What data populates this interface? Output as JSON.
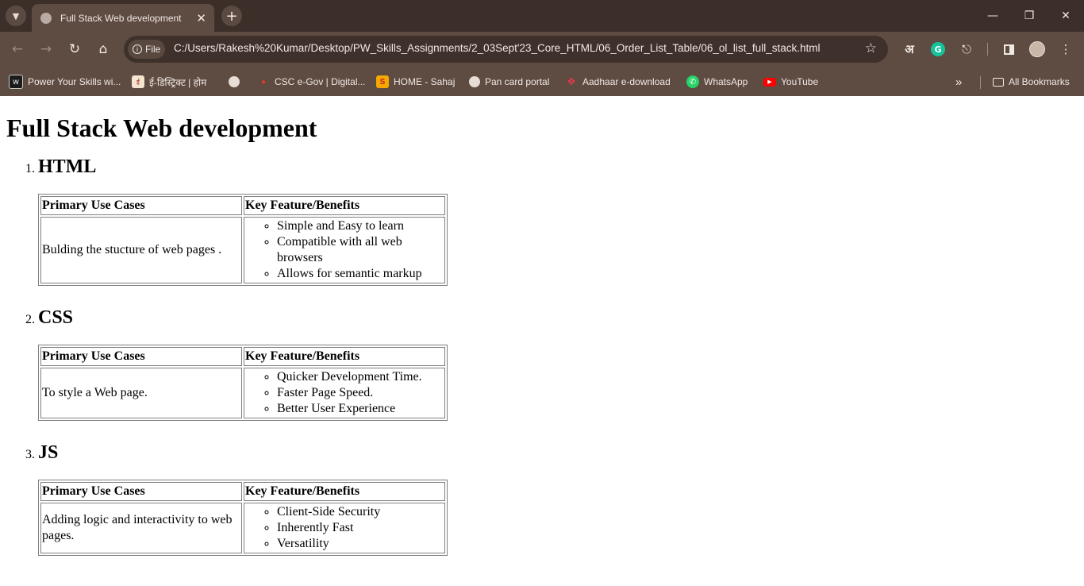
{
  "browser": {
    "tab_title": "Full Stack Web development",
    "site_chip": "File",
    "url": "C:/Users/Rakesh%20Kumar/Desktop/PW_Skills_Assignments/2_03Sept'23_Core_HTML/06_Order_List_Table/06_ol_list_full_stack.html",
    "bookmarks": [
      {
        "label": "Power Your Skills wi...",
        "icon": "pw-logo-icon"
      },
      {
        "label": "ई-डिस्ट्रिक्ट | होम",
        "icon": "edistrict-logo-icon"
      },
      {
        "label": "",
        "icon": "globe-icon"
      },
      {
        "label": "CSC e-Gov | Digital...",
        "icon": "csc-logo-icon"
      },
      {
        "label": "HOME - Sahaj",
        "icon": "sahaj-logo-icon"
      },
      {
        "label": "Pan card portal",
        "icon": "globe-icon"
      },
      {
        "label": "Aadhaar e-download",
        "icon": "aadhaar-logo-icon"
      },
      {
        "label": "WhatsApp",
        "icon": "whatsapp-icon"
      },
      {
        "label": "YouTube",
        "icon": "youtube-icon"
      }
    ],
    "all_bookmarks": "All Bookmarks",
    "hindi_icon_label": "अ"
  },
  "page": {
    "heading": "Full Stack Web development",
    "col1_header": "Primary Use Cases",
    "col2_header": "Key Feature/Benefits",
    "sections": [
      {
        "title": "HTML",
        "use_case": "Bulding the stucture of web pages .",
        "features": [
          "Simple and Easy to learn",
          "Compatible with all web browsers",
          "Allows for semantic markup"
        ]
      },
      {
        "title": "CSS",
        "use_case": "To style a Web page.",
        "features": [
          "Quicker Development Time.",
          "Faster Page Speed.",
          "Better User Experience"
        ]
      },
      {
        "title": "JS",
        "use_case": "Adding logic and interactivity to web pages.",
        "features": [
          "Client-Side Security",
          "Inherently Fast",
          "Versatility"
        ]
      }
    ]
  }
}
